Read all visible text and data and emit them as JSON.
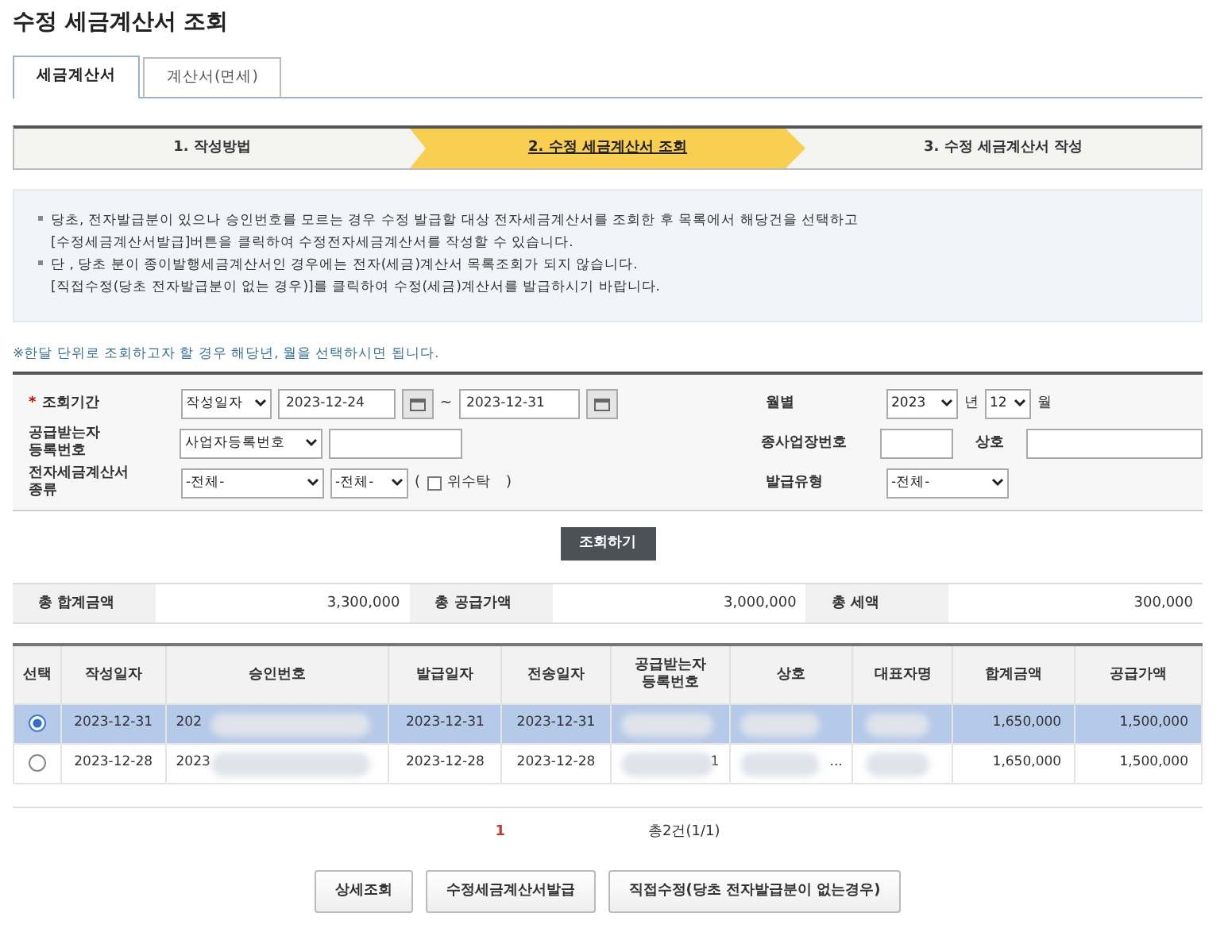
{
  "title": "수정 세금계산서 조회",
  "tabs": [
    {
      "label": "세금계산서",
      "selected": true
    },
    {
      "label": "계산서(면세)",
      "selected": false
    }
  ],
  "steps": [
    {
      "label": "1. 작성방법",
      "selected": false
    },
    {
      "label": "2. 수정 세금계산서 조회",
      "selected": true
    },
    {
      "label": "3. 수정 세금계산서 작성",
      "selected": false
    }
  ],
  "notice": [
    {
      "text": "당초, 전자발급분이 있으나 승인번호를 모르는 경우 수정 발급할 대상 전자세금계산서를 조회한 후 목록에서 해당건을 선택하고",
      "bullet": true
    },
    {
      "text": "[수정세금계산서발급]버튼을 클릭하여 수정전자세금계산서를 작성할 수 있습니다.",
      "bullet": false
    },
    {
      "text": "단 , 당초 분이 종이발행세금계산서인 경우에는 전자(세금)계산서 목록조회가 되지 않습니다.",
      "bullet": true
    },
    {
      "text": "[직접수정(당초 전자발급분이 없는 경우)]를 클릭하여 수정(세금)계산서를 발급하시기 바랍니다.",
      "bullet": false
    }
  ],
  "hint": "※한달 단위로 조회하고자 할 경우 해당년, 월을 선택하시면 됩니다.",
  "search": {
    "period": {
      "label": "조회기간",
      "required_mark": "*",
      "type_select": "작성일자",
      "from": "2023-12-24",
      "separator": "~",
      "to": "2023-12-31"
    },
    "monthly": {
      "label": "월별",
      "year": "2023",
      "year_unit": "년",
      "month": "12",
      "month_unit": "월"
    },
    "recipient": {
      "label": "공급받는자\n등록번호",
      "id_type": "사업자등록번호"
    },
    "branch": {
      "label": "종사업장번호"
    },
    "company": {
      "label": "상호"
    },
    "invoice_kind": {
      "label": "전자세금계산서\n종류",
      "select_1": "-전체-",
      "select_2": "-전체-",
      "paren_open": "(",
      "consign_label": "위수탁",
      "consign_checked": false,
      "paren_close": ")"
    },
    "issue_type": {
      "label": "발급유형",
      "value": "-전체-"
    },
    "button": "조회하기"
  },
  "summary": [
    {
      "label": "총 합계금액",
      "value": "3,300,000"
    },
    {
      "label": "총 공급가액",
      "value": "3,000,000"
    },
    {
      "label": "총 세액",
      "value": "300,000"
    }
  ],
  "table": {
    "columns": [
      "선택",
      "작성일자",
      "승인번호",
      "발급일자",
      "전송일자",
      "공급받는자\n등록번호",
      "상호",
      "대표자명",
      "합계금액",
      "공급가액"
    ],
    "rows": [
      {
        "selected": true,
        "cells": [
          "",
          "2023-12-31",
          "202",
          "2023-12-31",
          "2023-12-31",
          "",
          "",
          "",
          "1,650,000",
          "1,500,000"
        ]
      },
      {
        "selected": false,
        "cells": [
          "",
          "2023-12-28",
          "2023",
          "2023-12-28",
          "2023-12-28",
          "1",
          "...",
          "",
          "1,650,000",
          "1,500,000"
        ]
      }
    ]
  },
  "pagination": {
    "pages": [
      {
        "label": "1",
        "selected": true
      }
    ],
    "total": "총2건(1/1)"
  },
  "buttons": [
    "상세조회",
    "수정세금계산서발급",
    "직접수정(당초 전자발급분이 없는경우)"
  ]
}
